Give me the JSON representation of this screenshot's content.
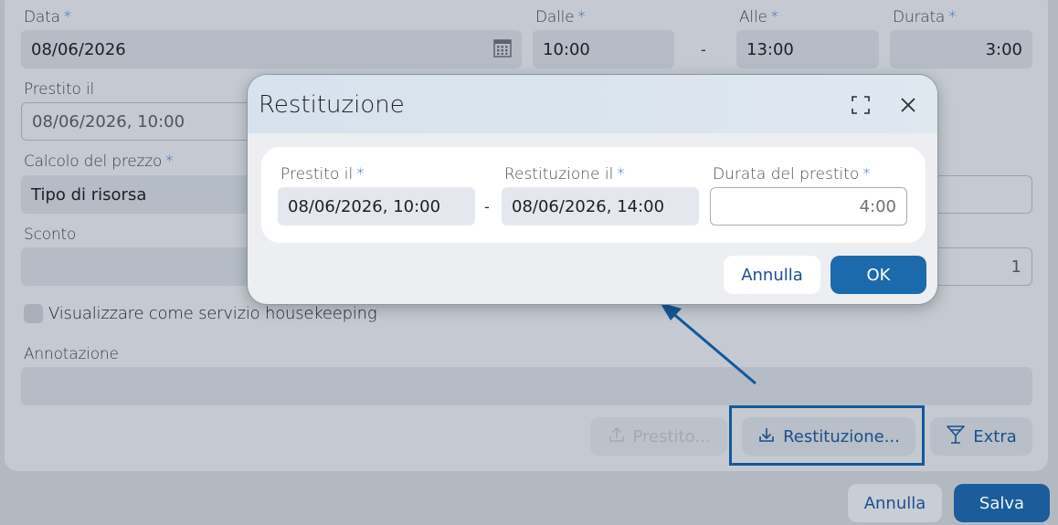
{
  "form": {
    "data_label": "Data",
    "data_value": "08/06/2026",
    "dalle_label": "Dalle",
    "dalle_value": "10:00",
    "range_dash": "-",
    "alle_label": "Alle",
    "alle_value": "13:00",
    "durata_label": "Durata",
    "durata_value": "3:00",
    "prestito_label": "Prestito il",
    "prestito_value": "08/06/2026, 10:00",
    "calcolo_label": "Calcolo del prezzo",
    "calcolo_value": "Tipo di risorsa",
    "sconto_label": "Sconto",
    "quantity_value": "1",
    "housekeeping_label": "Visualizzare come servizio housekeeping",
    "annotazione_label": "Annotazione",
    "required_mark": "*"
  },
  "actions": {
    "prestito_button": "Prestito...",
    "restituzione_button": "Restituzione...",
    "extra_button": "Extra",
    "annulla_button": "Annulla",
    "salva_button": "Salva"
  },
  "dialog": {
    "title": "Restituzione",
    "prestito_label": "Prestito il",
    "prestito_value": "08/06/2026, 10:00",
    "dash": "-",
    "restituzione_label": "Restituzione il",
    "restituzione_value": "08/06/2026, 14:00",
    "durata_label": "Durata del prestito",
    "durata_placeholder": "4:00",
    "annulla_button": "Annulla",
    "ok_button": "OK"
  },
  "icons": {
    "calendar": "calendar-icon",
    "maximize": "maximize-icon",
    "close": "close-icon",
    "upload": "upload-icon",
    "download": "download-icon",
    "cocktail": "cocktail-icon"
  },
  "colors": {
    "accent": "#1a5c9c",
    "required": "#2260a8",
    "callout": "#14589a"
  }
}
